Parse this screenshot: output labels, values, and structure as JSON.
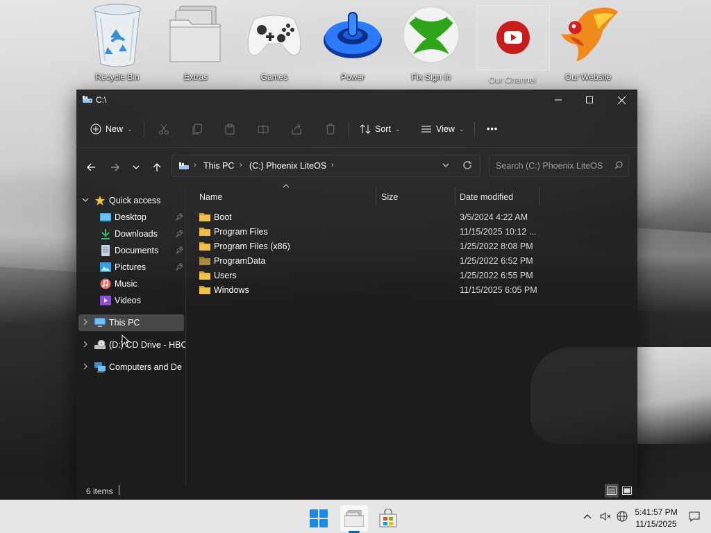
{
  "desktop": {
    "icons": [
      {
        "label": "Recycle Bin",
        "icon": "recycle-bin-icon"
      },
      {
        "label": "Extras",
        "icon": "folder-stack-icon"
      },
      {
        "label": "Games",
        "icon": "gamepad-icon"
      },
      {
        "label": "Power",
        "icon": "power-icon"
      },
      {
        "label": "Fix Sign In",
        "icon": "xbox-icon"
      },
      {
        "label": "Our Channel",
        "icon": "youtube-icon"
      },
      {
        "label": "Our Website",
        "icon": "phoenix-logo-icon"
      }
    ]
  },
  "window": {
    "title": "C:\\",
    "toolbar": {
      "new_label": "New",
      "sort_label": "Sort",
      "view_label": "View",
      "more_label": "•••"
    },
    "address": {
      "segments": [
        "This PC",
        "(C:) Phoenix LiteOS"
      ]
    },
    "search": {
      "placeholder": "Search (C:) Phoenix LiteOS"
    },
    "nav": {
      "quick_access": "Quick access",
      "pinned": [
        {
          "label": "Desktop",
          "icon": "desktop-icon",
          "pinned": true
        },
        {
          "label": "Downloads",
          "icon": "download-icon",
          "pinned": true
        },
        {
          "label": "Documents",
          "icon": "documents-icon",
          "pinned": true
        },
        {
          "label": "Pictures",
          "icon": "pictures-icon",
          "pinned": true
        },
        {
          "label": "Music",
          "icon": "music-icon",
          "pinned": false
        },
        {
          "label": "Videos",
          "icon": "videos-icon",
          "pinned": false
        }
      ],
      "this_pc": "This PC",
      "drive": "(D:) CD Drive - HBC",
      "network": "Computers and De"
    },
    "columns": {
      "name": "Name",
      "size": "Size",
      "date": "Date modified"
    },
    "files": [
      {
        "name": "Boot",
        "date": "3/5/2024 4:22 AM"
      },
      {
        "name": "Program Files",
        "date": "11/15/2025 10:12 ..."
      },
      {
        "name": "Program Files (x86)",
        "date": "1/25/2022 8:08 PM"
      },
      {
        "name": "ProgramData",
        "date": "1/25/2022 6:52 PM"
      },
      {
        "name": "Users",
        "date": "1/25/2022 6:55 PM"
      },
      {
        "name": "Windows",
        "date": "11/15/2025 6:05 PM"
      }
    ],
    "status": {
      "item_count": "6 items"
    }
  },
  "taskbar": {
    "apps": [
      "start-icon",
      "file-explorer-icon",
      "store-icon"
    ],
    "clock": {
      "time": "5:41:57 PM",
      "date": "11/15/2025"
    }
  },
  "colors": {
    "window_bg": "#1c1c1c",
    "folder": "#f2c04a",
    "accent": "#0067c0"
  }
}
